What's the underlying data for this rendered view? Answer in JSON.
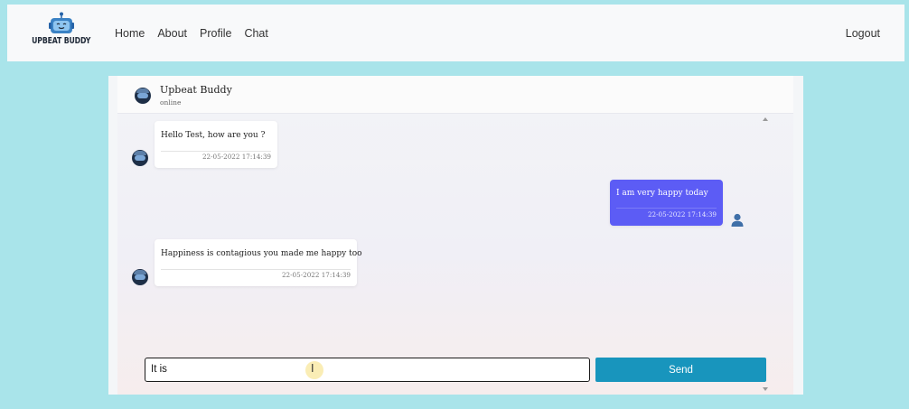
{
  "nav": {
    "brand_text": "UPBEAT BUDDY",
    "links": [
      "Home",
      "About",
      "Profile",
      "Chat"
    ],
    "logout_label": "Logout"
  },
  "chat": {
    "header": {
      "name": "Upbeat Buddy",
      "status": "online"
    },
    "messages": [
      {
        "sender": "bot",
        "text": "Hello Test, how are you ?",
        "time": "22-05-2022 17:14:39"
      },
      {
        "sender": "user",
        "text": "I am very happy today",
        "time": "22-05-2022 17:14:39"
      },
      {
        "sender": "bot",
        "text": "Happiness is contagious you made me happy too",
        "time": "22-05-2022 17:14:39"
      }
    ],
    "input_value": "It is",
    "send_label": "Send"
  },
  "colors": {
    "background": "#a9e4ea",
    "user_bubble": "#5c5cf5",
    "send_button": "#1895bd"
  }
}
